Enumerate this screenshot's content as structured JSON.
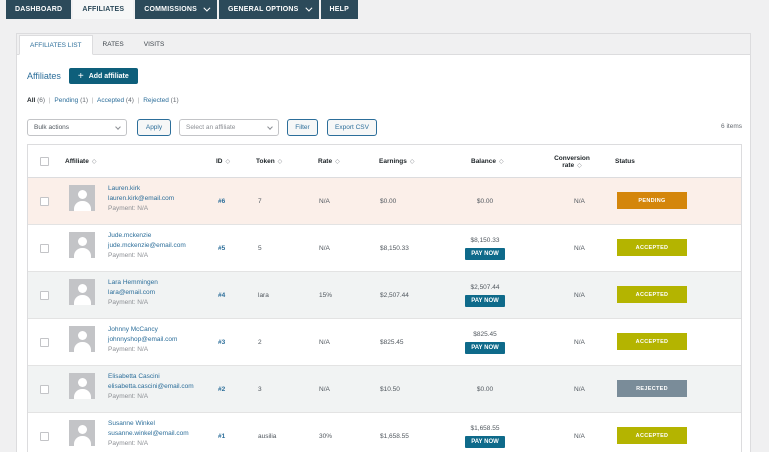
{
  "nav": {
    "tabs": [
      {
        "label": "DASHBOARD"
      },
      {
        "label": "AFFILIATES"
      },
      {
        "label": "COMMISSIONS"
      },
      {
        "label": "GENERAL OPTIONS"
      },
      {
        "label": "HELP"
      }
    ]
  },
  "subtabs": [
    {
      "label": "AFFILIATES LIST"
    },
    {
      "label": "RATES"
    },
    {
      "label": "VISITS"
    }
  ],
  "page": {
    "title": "Affiliates",
    "add_label": "Add affiliate"
  },
  "filters": [
    {
      "label": "All",
      "count": "(6)"
    },
    {
      "label": "Pending",
      "count": "(1)"
    },
    {
      "label": "Accepted",
      "count": "(4)"
    },
    {
      "label": "Rejected",
      "count": "(1)"
    }
  ],
  "actions": {
    "bulk_placeholder": "Bulk actions",
    "apply_label": "Apply",
    "select_affiliate_placeholder": "Select an affiliate",
    "filter_label": "Filter",
    "export_label": "Export CSV",
    "items_count": "6 items"
  },
  "columns": {
    "affiliate": "Affiliate",
    "id": "ID",
    "token": "Token",
    "rate": "Rate",
    "earnings": "Earnings",
    "balance": "Balance",
    "conversion_1": "Conversion",
    "conversion_2": "rate",
    "status": "Status",
    "sort_icon": "sort-arrows-icon"
  },
  "pay_now_label": "PAY NOW",
  "status_colors": {
    "PENDING": "#d4860b",
    "ACCEPTED": "#b4b400",
    "REJECTED": "#7a8c99"
  },
  "rows": [
    {
      "name": "Lauren.kirk",
      "email": "lauren.kirk@email.com",
      "payment": "Payment: N/A",
      "id": "#6",
      "token": "7",
      "rate": "N/A",
      "earnings": "$0.00",
      "balance": "$0.00",
      "conversion": "N/A",
      "status": "PENDING"
    },
    {
      "name": "Jude.mckenzie",
      "email": "jude.mckenzie@email.com",
      "payment": "Payment: N/A",
      "id": "#5",
      "token": "5",
      "rate": "N/A",
      "earnings": "$8,150.33",
      "balance": "$8,150.33",
      "conversion": "N/A",
      "status": "ACCEPTED"
    },
    {
      "name": "Lara Hemmingen",
      "email": "lara@email.com",
      "payment": "Payment: N/A",
      "id": "#4",
      "token": "lara",
      "rate": "15%",
      "earnings": "$2,507.44",
      "balance": "$2,507.44",
      "conversion": "N/A",
      "status": "ACCEPTED"
    },
    {
      "name": "Johnny McCancy",
      "email": "johnnyshop@email.com",
      "payment": "Payment: N/A",
      "id": "#3",
      "token": "2",
      "rate": "N/A",
      "earnings": "$825.45",
      "balance": "$825.45",
      "conversion": "N/A",
      "status": "ACCEPTED"
    },
    {
      "name": "Elisabetta Cascini",
      "email": "elisabetta.cascini@email.com",
      "payment": "Payment: N/A",
      "id": "#2",
      "token": "3",
      "rate": "N/A",
      "earnings": "$10.50",
      "balance": "$0.00",
      "conversion": "N/A",
      "status": "REJECTED"
    },
    {
      "name": "Susanne Winkel",
      "email": "susanne.winkel@email.com",
      "payment": "Payment: N/A",
      "id": "#1",
      "token": "ausilia",
      "rate": "30%",
      "earnings": "$1,658.55",
      "balance": "$1,658.55",
      "conversion": "N/A",
      "status": "ACCEPTED"
    }
  ],
  "row_backgrounds": [
    "#fbefe9",
    "#ffffff",
    "#f1f3f3",
    "#ffffff",
    "#f1f3f3",
    "#ffffff"
  ],
  "pay_now_rows": [
    false,
    true,
    true,
    true,
    false,
    true
  ]
}
